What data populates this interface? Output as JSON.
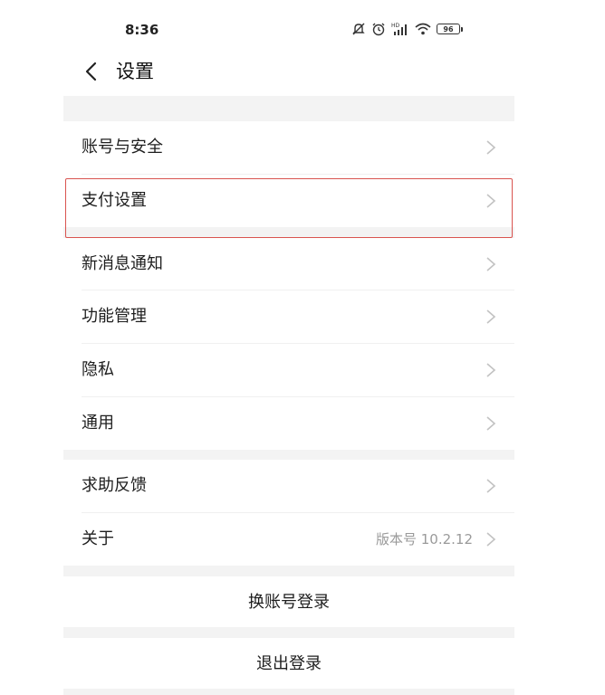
{
  "status_bar": {
    "time": "8:36",
    "battery": "96"
  },
  "header": {
    "title": "设置"
  },
  "groups": {
    "account_security": "账号与安全",
    "payment_settings": "支付设置",
    "notifications": "新消息通知",
    "features": "功能管理",
    "privacy": "隐私",
    "general": "通用",
    "help_feedback": "求助反馈",
    "about": "关于",
    "about_version": "版本号 10.2.12"
  },
  "actions": {
    "switch_account": "换账号登录",
    "logout": "退出登录"
  },
  "colors": {
    "highlight": "#d9534f",
    "section_gap": "#f3f3f3",
    "chevron": "#c2c2c2"
  },
  "icons": [
    "back-icon",
    "chevron-right-icon",
    "mute-icon",
    "alarm-icon",
    "signal-icon",
    "wifi-icon",
    "battery-icon"
  ]
}
